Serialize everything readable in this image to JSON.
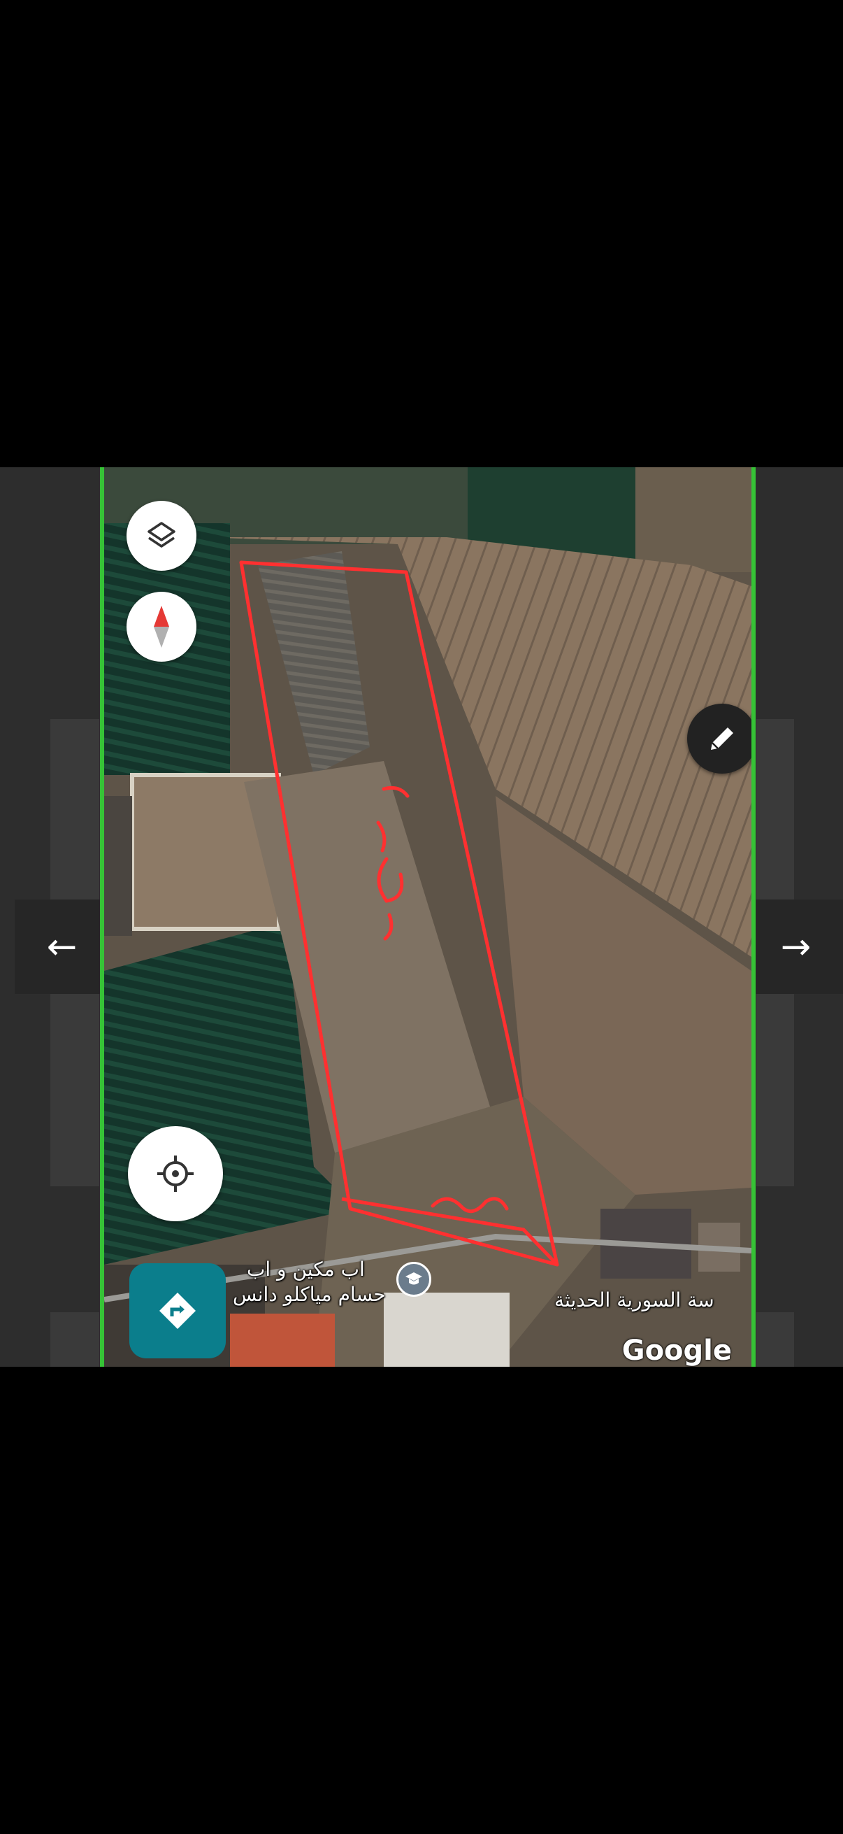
{
  "gallery": {
    "prev_icon": "arrow-left-icon",
    "next_icon": "arrow-right-icon",
    "prev_glyph": "←",
    "next_glyph": "→"
  },
  "map": {
    "controls": {
      "layers_icon": "layers-icon",
      "compass_icon": "compass-icon",
      "edit_icon": "pencil-icon",
      "locate_icon": "my-location-icon",
      "directions_icon": "directions-icon"
    },
    "labels": {
      "place_line1": "اب مكين و اب",
      "place_line2": "حسام ميا‌كلو دانس",
      "school_name": "سة السورية الحديثة",
      "school_icon": "graduation-cap-icon"
    },
    "annotation": {
      "color": "#ff3030"
    },
    "attribution": "Google"
  },
  "colors": {
    "viewer_border": "#36c236",
    "directions_button": "#0b7e8c",
    "outline": "#ff3030"
  }
}
